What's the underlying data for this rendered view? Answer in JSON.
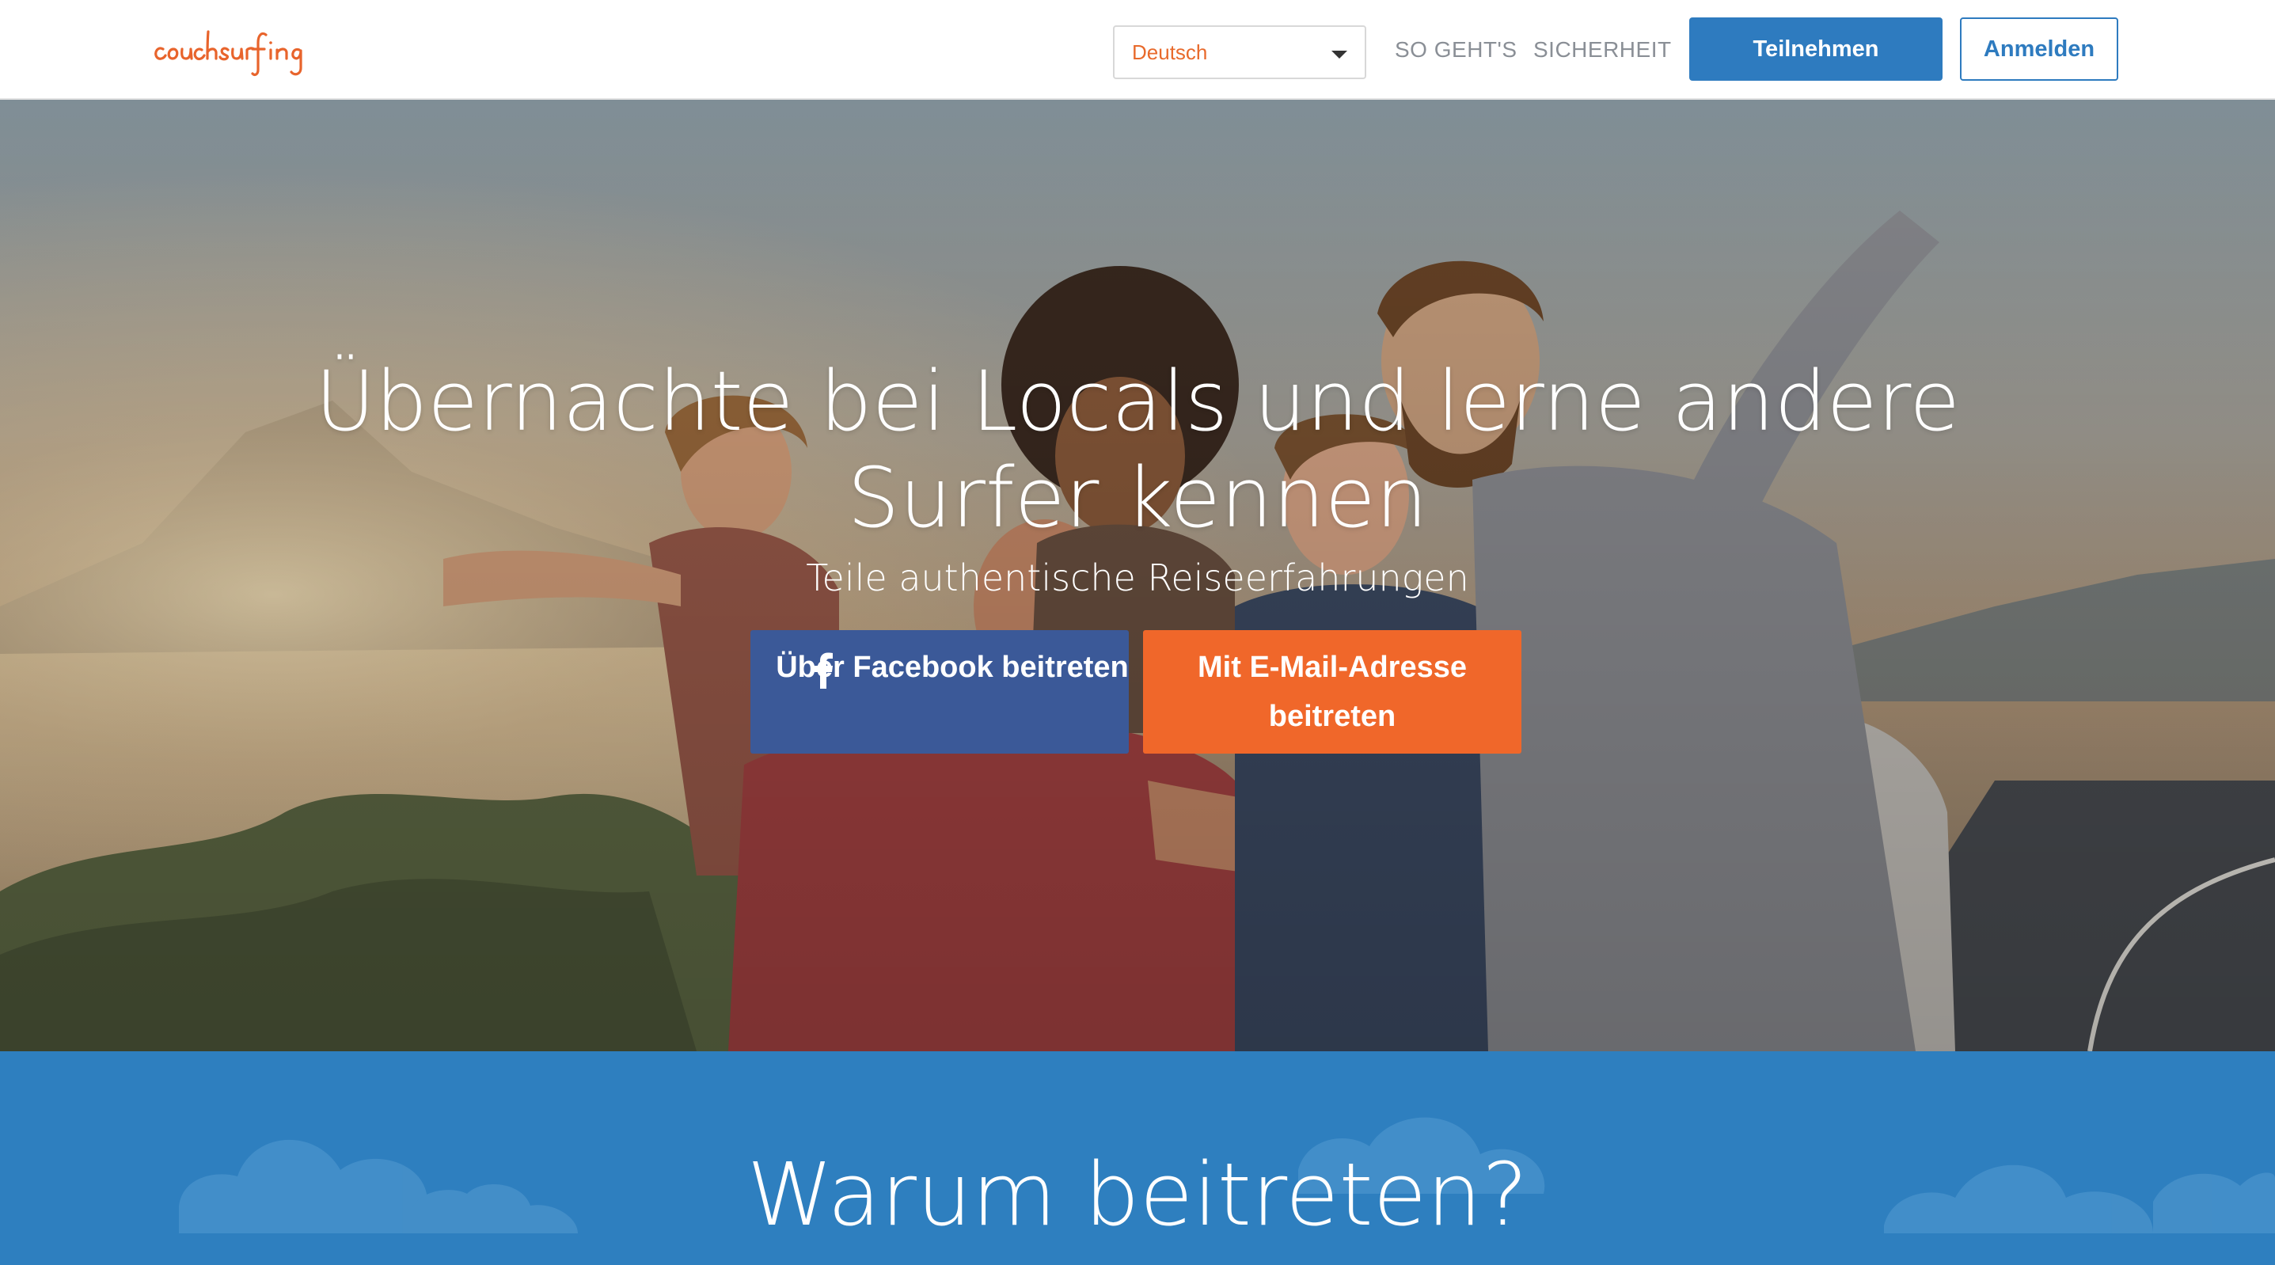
{
  "header": {
    "logo_text": "couchsurfing",
    "language_select": {
      "value": "Deutsch"
    },
    "nav": {
      "how_it_works": "SO GEHT'S",
      "safety": "SICHERHEIT"
    },
    "join_button": "Teilnehmen",
    "login_button": "Anmelden"
  },
  "hero": {
    "title": "Übernachte bei Locals und lerne andere Surfer kennen",
    "subtitle": "Teile authentische Reiseerfahrungen",
    "facebook_button": "Über Facebook beitreten",
    "email_button": "Mit E-Mail-Adresse beitreten"
  },
  "why_section": {
    "title": "Warum beitreten?"
  },
  "colors": {
    "brand_orange": "#f0672a",
    "brand_blue": "#2e7bbf",
    "facebook_blue": "#3b5998",
    "nav_gray": "#8a8f96"
  },
  "icons": {
    "facebook": "facebook-icon",
    "dropdown": "chevron-down-icon"
  }
}
